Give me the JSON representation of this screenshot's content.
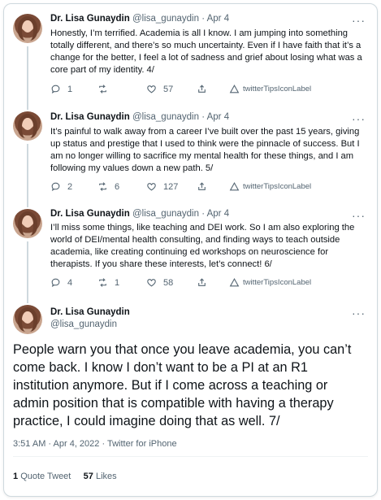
{
  "thread": [
    {
      "author_name": "Dr. Lisa Gunaydin",
      "handle": "@lisa_gunaydin",
      "separator": "·",
      "date": "Apr 4",
      "text": "Honestly, I’m terrified. Academia is all I know. I am jumping into something totally different, and there’s so much uncertainty. Even if I have faith that it’s a change for the better, I feel a lot of sadness and grief about losing what was a core part of my identity. 4/",
      "replies": "1",
      "retweets": "",
      "likes": "57",
      "tips_label": "twitterTipsIconLabel"
    },
    {
      "author_name": "Dr. Lisa Gunaydin",
      "handle": "@lisa_gunaydin",
      "separator": "·",
      "date": "Apr 4",
      "text": "It’s painful to walk away from a career I’ve built over the past 15 years, giving up status and prestige that I used to think were the pinnacle of success. But I am no longer willing to sacrifice my mental health for these things, and I am following my values down a new path. 5/",
      "replies": "2",
      "retweets": "6",
      "likes": "127",
      "tips_label": "twitterTipsIconLabel"
    },
    {
      "author_name": "Dr. Lisa Gunaydin",
      "handle": "@lisa_gunaydin",
      "separator": "·",
      "date": "Apr 4",
      "text": "I’ll miss some things, like teaching and DEI work. So I am also exploring the world of DEI/mental health consulting, and finding ways to teach outside academia, like creating continuing ed workshops on neuroscience for therapists. If you share these interests, let’s connect! 6/",
      "replies": "4",
      "retweets": "1",
      "likes": "58",
      "tips_label": "twitterTipsIconLabel"
    }
  ],
  "main_tweet": {
    "author_name": "Dr. Lisa Gunaydin",
    "handle": "@lisa_gunaydin",
    "text": "People warn you that once you leave academia, you can’t come back. I know I don’t want to be a PI at an R1 institution anymore. But if I come across a teaching or admin position that is compatible with having a therapy practice, I could imagine doing that as well. 7/",
    "timestamp": "3:51 AM · Apr 4, 2022 · Twitter for iPhone",
    "quote_count": "1",
    "quote_label": "Quote Tweet",
    "like_count": "57",
    "like_label": "Likes"
  },
  "more_label": "···",
  "icons": {
    "reply": "reply-icon",
    "retweet": "retweet-icon",
    "like": "heart-icon",
    "share": "share-icon",
    "tips": "tips-icon",
    "more": "more-icon"
  },
  "colors": {
    "text": "#0f1419",
    "secondary": "#536471",
    "border": "#cfd9de"
  }
}
